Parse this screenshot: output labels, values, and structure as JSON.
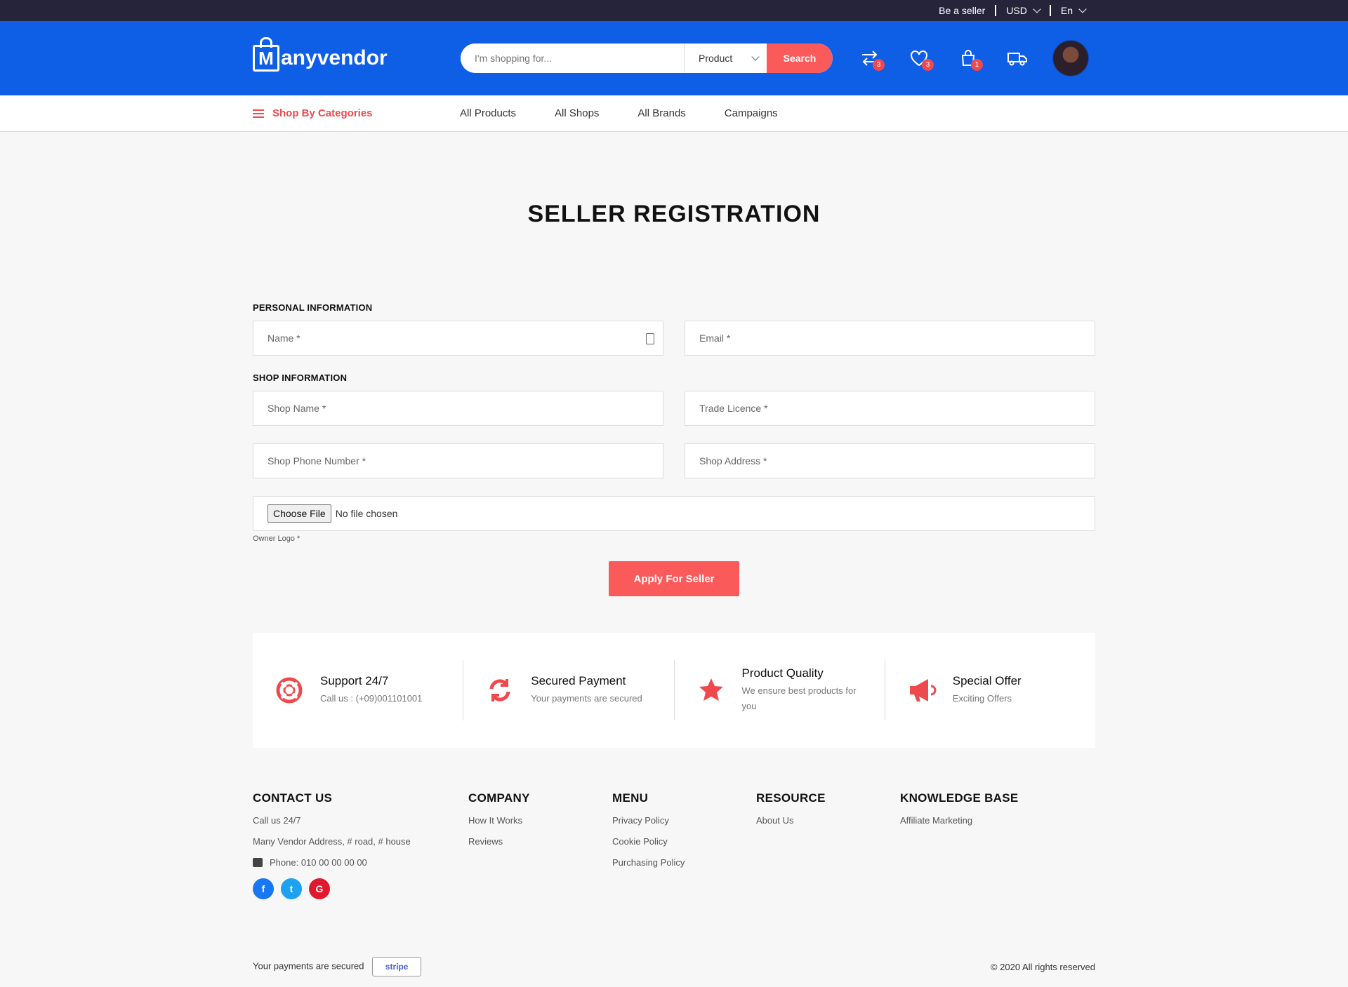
{
  "topbar": {
    "seller": "Be a seller",
    "currency": "USD",
    "language": "En"
  },
  "header": {
    "logo": "anyvendor",
    "logo_initial": "M",
    "search": {
      "placeholder": "I'm shopping for...",
      "category": "Product",
      "button": "Search"
    },
    "badges": {
      "compare": "3",
      "wishlist": "3",
      "cart": "1"
    }
  },
  "nav": {
    "categories": "Shop By Categories",
    "links": [
      "All Products",
      "All Shops",
      "All Brands",
      "Campaigns"
    ]
  },
  "page": {
    "title": "SELLER REGISTRATION",
    "personal_label": "PERSONAL INFORMATION",
    "shop_label": "SHOP INFORMATION",
    "fields": {
      "name": "Name *",
      "email": "Email *",
      "shop_name": "Shop Name *",
      "trade_licence": "Trade Licence *",
      "shop_phone": "Shop Phone Number *",
      "shop_address": "Shop Address *"
    },
    "file_button": "Choose File",
    "file_status": "No file chosen",
    "file_hint": "Owner Logo *",
    "apply": "Apply For Seller"
  },
  "features": [
    {
      "title": "Support 24/7",
      "sub": "Call us : (+09)001101001",
      "icon": "lifebuoy-icon"
    },
    {
      "title": "Secured Payment",
      "sub": "Your payments are secured",
      "icon": "refresh-icon"
    },
    {
      "title": "Product Quality",
      "sub": "We ensure best products for you",
      "icon": "star-icon"
    },
    {
      "title": "Special Offer",
      "sub": "Exciting Offers",
      "icon": "megaphone-icon"
    }
  ],
  "footer": {
    "contact": {
      "title": "CONTACT US",
      "call": "Call us 24/7",
      "address": "Many Vendor Address, # road, # house",
      "phone": "Phone: 010 00 00 00 00"
    },
    "company": {
      "title": "COMPANY",
      "links": [
        "How It Works",
        "Reviews"
      ]
    },
    "menu": {
      "title": "MENU",
      "links": [
        "Privacy Policy",
        "Cookie Policy",
        "Purchasing Policy"
      ]
    },
    "resource": {
      "title": "RESOURCE",
      "links": [
        "About Us"
      ]
    },
    "knowledge": {
      "title": "KNOWLEDGE BASE",
      "links": [
        "Affiliate Marketing"
      ]
    },
    "social": {
      "facebook": "f",
      "twitter": "t",
      "google": "G"
    },
    "payments": "Your payments are secured",
    "stripe": "stripe",
    "copyright": "© 2020 All rights reserved"
  },
  "colors": {
    "primary": "#0f5ee6",
    "accent": "#fb5a5a",
    "topbar": "#26243a"
  }
}
